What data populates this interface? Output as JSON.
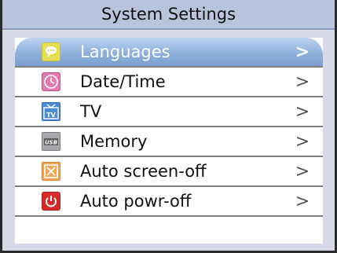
{
  "header": {
    "title": "System Settings"
  },
  "menu": {
    "items": [
      {
        "label": "Languages",
        "icon": "speech-bubble-icon",
        "arrow": ">",
        "selected": true
      },
      {
        "label": "Date/Time",
        "icon": "clock-icon",
        "arrow": ">"
      },
      {
        "label": "TV",
        "icon": "tv-icon",
        "arrow": ">"
      },
      {
        "label": "Memory",
        "icon": "usb-icon",
        "arrow": ">"
      },
      {
        "label": "Auto screen-off",
        "icon": "screen-off-icon",
        "arrow": ">"
      },
      {
        "label": "Auto powr-off",
        "icon": "power-icon",
        "arrow": ">"
      }
    ]
  },
  "icon_text": {
    "tv": "TV",
    "usb": "USB"
  },
  "colors": {
    "title_bar": "#b9c3dd",
    "selected_row": "#8fb0dc",
    "background": "#d7dae6",
    "power_red": "#d62b2b"
  }
}
